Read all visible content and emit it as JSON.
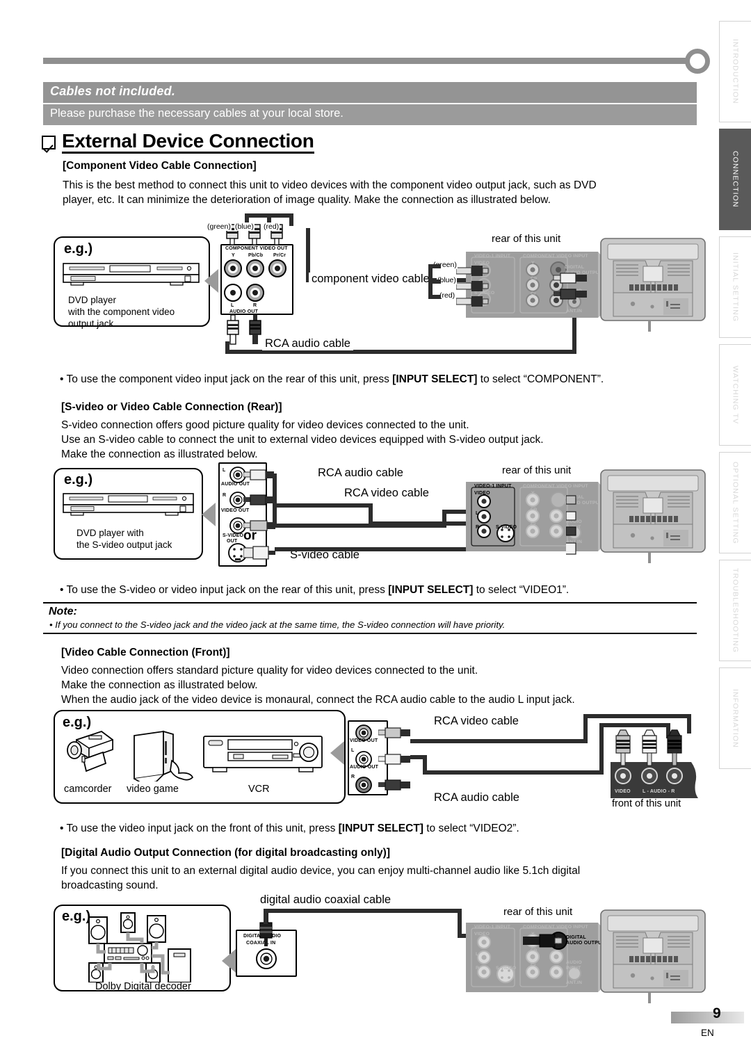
{
  "banner": {
    "title": "Cables not included.",
    "subtitle": "Please purchase the necessary cables at your local store."
  },
  "heading": "External Device Connection",
  "sections": {
    "component": {
      "title": "[Component Video Cable Connection]",
      "body_line1": "This is the best method to connect this unit to video devices with the component video output jack, such as DVD",
      "body_line2": "player, etc. It can minimize the deterioration of image quality. Make the connection as illustrated below.",
      "bullet_pre": "• To use the component video input jack on the rear of this unit, press ",
      "bullet_key": "[INPUT SELECT]",
      "bullet_post": " to select “COMPONENT”."
    },
    "svideo": {
      "title": "[S-video or Video Cable Connection (Rear)]",
      "body_line1": "S-video connection offers good picture quality for video devices connected to the unit.",
      "body_line2": "Use an S-video cable to connect the unit to external video devices equipped with S-video output jack.",
      "body_line3": "Make the connection as illustrated below.",
      "bullet_pre": "• To use the S-video or video input jack on the rear of this unit, press ",
      "bullet_key": "[INPUT SELECT]",
      "bullet_post": " to select “VIDEO1”."
    },
    "note": {
      "title": "Note:",
      "text": "• If you connect to the S-video jack and the video jack at the same time, the S-video connection will have priority."
    },
    "front": {
      "title": "[Video Cable Connection (Front)]",
      "body_line1": "Video connection offers standard picture quality for video devices connected to the unit.",
      "body_line2": "Make the connection as illustrated below.",
      "body_line3": "When the audio jack of the video device is monaural, connect the RCA audio cable to the audio L input jack.",
      "bullet_pre": "• To use the video input jack on the front of this unit, press ",
      "bullet_key": "[INPUT SELECT]",
      "bullet_post": " to select “VIDEO2”."
    },
    "digital": {
      "title": "[Digital Audio Output Connection (for digital broadcasting only)]",
      "body_line1": "If you connect this unit to an external digital audio device, you can enjoy multi-channel audio like 5.1ch digital",
      "body_line2": "broadcasting sound."
    }
  },
  "figures": {
    "fig1": {
      "eg": "e.g.)",
      "device_caption": "DVD player\nwith the component video\noutput jack",
      "device_caption_l1": "DVD player",
      "device_caption_l2": "with the component video",
      "device_caption_l3": "output jack",
      "src_panel": {
        "comp_label": "COMPONENT VIDEO OUT",
        "y": "Y",
        "pbcb": "Pb/Cb",
        "prcr": "Pr/Cr",
        "l": "L",
        "r": "R",
        "audio_label": "AUDIO OUT"
      },
      "plug_colors": [
        "(green)",
        "(blue)",
        "(red)"
      ],
      "cable_component": "component video cable",
      "cable_audio": "RCA audio cable",
      "rear_label": "rear of this unit",
      "dst_panel": {
        "video1": "VIDEO-1 INPUT",
        "video": "VIDEO",
        "svideo": "S-VIDEO",
        "comp": "COMPONENT VIDEO INPUT",
        "y": "Y",
        "cb": "Cb",
        "cr": "Cr",
        "l": "L",
        "r": "R",
        "digital": "DIGITAL\nAUDIO OUTPUT",
        "digital_l1": "DIGITAL",
        "digital_l2": "AUDIO OUTPUT",
        "audio_input_l1": "AUDIO",
        "audio_input_l2": "INPUT",
        "ant": "ANT.IN"
      },
      "dst_colors": [
        "(green)",
        "(blue)",
        "(red)"
      ]
    },
    "fig2": {
      "eg": "e.g.)",
      "device_caption_l1": "DVD player with",
      "device_caption_l2": "the S-video output jack",
      "src_panel": {
        "l": "L",
        "audio_out": "AUDIO OUT",
        "r": "R",
        "video_out": "VIDEO OUT",
        "svideo_out_l1": "S-VIDEO",
        "svideo_out_l2": "OUT"
      },
      "cable_audio": "RCA audio cable",
      "cable_video": "RCA video cable",
      "cable_svideo": "S-video cable",
      "or": "or",
      "rear_label": "rear of this unit",
      "dst_panel": {
        "video1": "VIDEO-1 INPUT",
        "video": "VIDEO",
        "l": "L",
        "r": "R",
        "svideo": "S-VIDEO",
        "comp": "COMPONENT VIDEO INPUT",
        "y": "Y",
        "cb": "Cb",
        "cr": "Cr",
        "digital_l1": "DIGITAL",
        "digital_l2": "AUDIO OUTPUT",
        "audio_input_l1": "AUDIO",
        "audio_input_l2": "INPUT",
        "ant": "ANT.IN"
      }
    },
    "fig3": {
      "eg": "e.g.)",
      "devices": [
        "camcorder",
        "video game",
        "VCR"
      ],
      "src_panel": {
        "video_out": "VIDEO OUT",
        "l": "L",
        "audio_out": "AUDIO OUT",
        "r": "R"
      },
      "cable_video": "RCA video cable",
      "cable_audio": "RCA audio cable",
      "front_panel": {
        "video": "VIDEO",
        "audio": "L - AUDIO - R"
      },
      "front_label": "front of this unit"
    },
    "fig4": {
      "eg": "e.g.)",
      "decoder_caption": "Dolby Digital decoder",
      "jack_l1": "DIGITAL AUDIO",
      "jack_l2": "COAXIAL IN",
      "cable": "digital audio coaxial cable",
      "rear_label": "rear of this unit",
      "dst_panel": {
        "video1": "VIDEO-1 INPUT",
        "video": "VIDEO",
        "l": "L",
        "r": "R",
        "svideo": "S-VIDEO",
        "comp": "COMPONENT VIDEO INPUT",
        "y": "Y",
        "cb": "Cb",
        "cr": "Cr",
        "digital_l1": "DIGITAL",
        "digital_l2": "AUDIO OUTPUT",
        "audio_input_l1": "AUDIO",
        "audio_input_l2": "INPUT",
        "ant": "ANT.IN"
      }
    }
  },
  "tabs": [
    {
      "label": "INTRODUCTION",
      "active": false
    },
    {
      "label": "CONNECTION",
      "active": true
    },
    {
      "label": "INITIAL  SETTING",
      "active": false
    },
    {
      "label": "WATCHING  TV",
      "active": false
    },
    {
      "label": "OPTIONAL  SETTING",
      "active": false
    },
    {
      "label": "TROUBLESHOOTING",
      "active": false
    },
    {
      "label": "INFORMATION",
      "active": false
    }
  ],
  "footer": {
    "page": "9",
    "lang": "EN"
  }
}
